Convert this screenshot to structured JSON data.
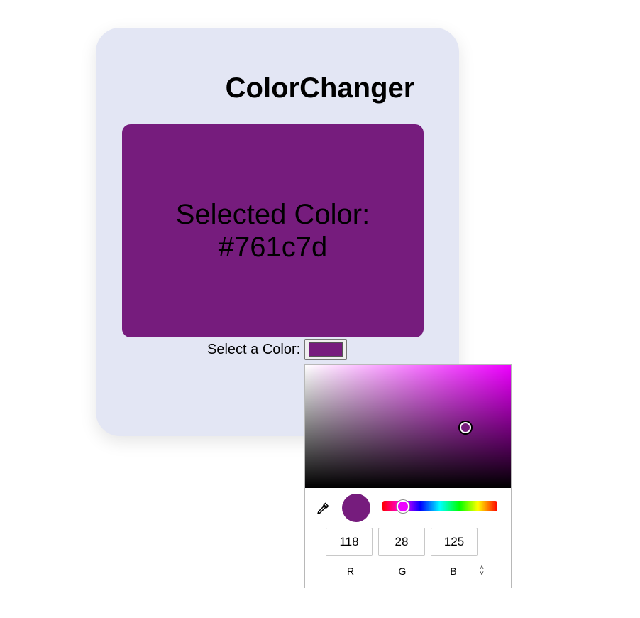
{
  "app": {
    "title": "ColorChanger",
    "selected_prefix": "Selected Color:",
    "selected_hex": "#761c7d",
    "picker_label": "Select a Color:",
    "card_color": "#e3e6f4"
  },
  "color_picker": {
    "hue_color": "#ee00ff",
    "saturation": 0.78,
    "value": 0.49,
    "hue_position": 0.18,
    "rgb": {
      "r": "118",
      "g": "28",
      "b": "125"
    },
    "channel_labels": {
      "r": "R",
      "g": "G",
      "b": "B"
    },
    "eyedropper_icon": "eyedropper-icon",
    "format_toggle_icon": "chevron-up-down-icon"
  }
}
